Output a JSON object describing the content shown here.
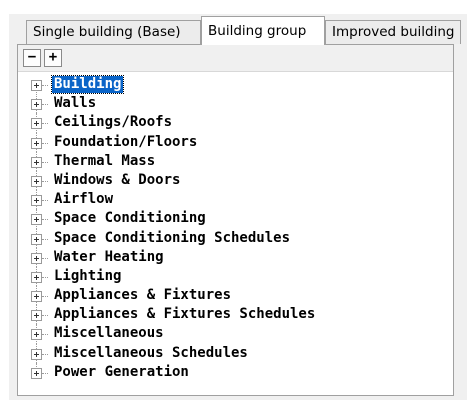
{
  "tabs": [
    {
      "label": "Single building (Base)",
      "active": false
    },
    {
      "label": "Building group",
      "active": true
    },
    {
      "label": "Improved building",
      "active": false
    }
  ],
  "toolbar": {
    "collapse_label": "−",
    "expand_label": "+"
  },
  "tree": {
    "selected": "Building",
    "items": [
      {
        "label": "Building"
      },
      {
        "label": "Walls"
      },
      {
        "label": "Ceilings/Roofs"
      },
      {
        "label": "Foundation/Floors"
      },
      {
        "label": "Thermal Mass"
      },
      {
        "label": "Windows & Doors"
      },
      {
        "label": "Airflow"
      },
      {
        "label": "Space Conditioning"
      },
      {
        "label": "Space Conditioning Schedules"
      },
      {
        "label": "Water Heating"
      },
      {
        "label": "Lighting"
      },
      {
        "label": "Appliances & Fixtures"
      },
      {
        "label": "Appliances & Fixtures Schedules"
      },
      {
        "label": "Miscellaneous"
      },
      {
        "label": "Miscellaneous Schedules"
      },
      {
        "label": "Power Generation"
      }
    ]
  },
  "colors": {
    "selection": "#0a64c8",
    "window_bg": "#f0f0f0"
  }
}
